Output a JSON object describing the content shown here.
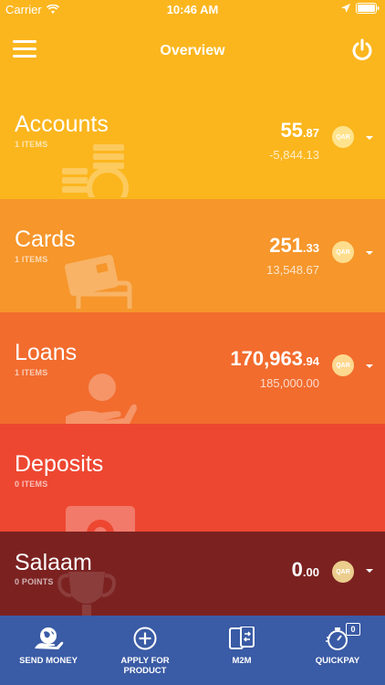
{
  "status_bar": {
    "carrier": "Carrier",
    "time": "10:46 AM"
  },
  "header": {
    "title": "Overview"
  },
  "sections": [
    {
      "title": "Accounts",
      "count": "1 ITEMS",
      "amount_int": "55",
      "amount_dec": ".87",
      "sub_amount": "-5,844.13",
      "currency": "QAR"
    },
    {
      "title": "Cards",
      "count": "1 ITEMS",
      "amount_int": "251",
      "amount_dec": ".33",
      "sub_amount": "13,548.67",
      "currency": "QAR"
    },
    {
      "title": "Loans",
      "count": "1 ITEMS",
      "amount_int": "170,963",
      "amount_dec": ".94",
      "sub_amount": "185,000.00",
      "currency": "QAR"
    },
    {
      "title": "Deposits",
      "count": "0 ITEMS"
    },
    {
      "title": "Salaam",
      "count": "0  POINTS",
      "amount_int": "0",
      "amount_dec": ".00",
      "currency": "QAR"
    }
  ],
  "bottom_tabs": [
    {
      "label": "SEND MONEY"
    },
    {
      "label": "APPLY FOR\nPRODUCT"
    },
    {
      "label": "M2M"
    },
    {
      "label": "QUICKPAY",
      "badge": "0"
    }
  ],
  "colors": {
    "accounts": "#fbb61e",
    "cards": "#f6962b",
    "loans": "#f26c2e",
    "deposits": "#ed4731",
    "salaam": "#7b2221",
    "bottom_bar": "#3a5ba5"
  }
}
